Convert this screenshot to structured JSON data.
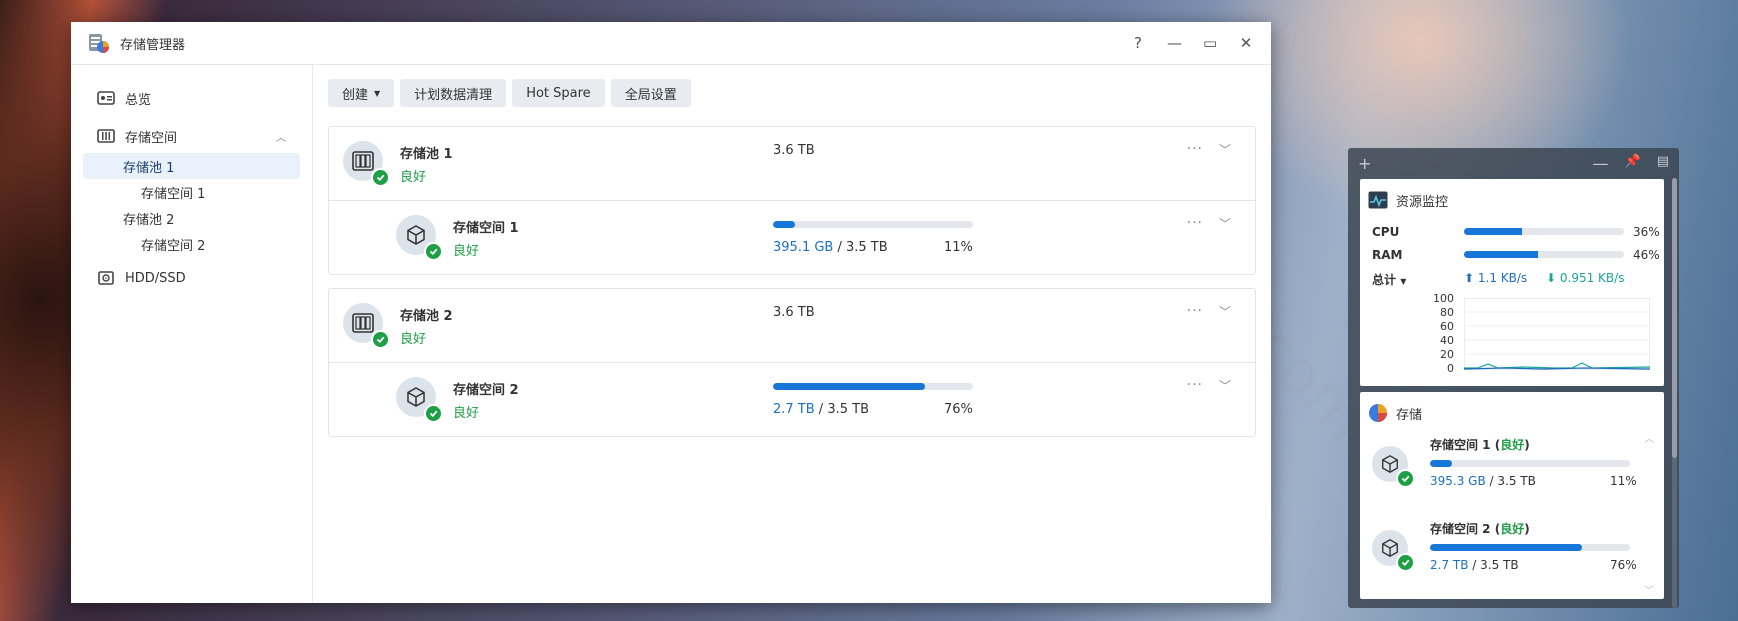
{
  "window": {
    "title": "存储管理器",
    "controls": {
      "help": "?",
      "minimize": "—",
      "maximize": "▭",
      "close": "✕"
    }
  },
  "sidebar": {
    "items": [
      {
        "label": "总览",
        "icon": "overview-icon"
      },
      {
        "label": "存储空间",
        "icon": "storage-icon",
        "expanded": true
      },
      {
        "label": "存储池 1"
      },
      {
        "label": "存储空间 1"
      },
      {
        "label": "存储池 2"
      },
      {
        "label": "存储空间 2"
      },
      {
        "label": "HDD/SSD",
        "icon": "disk-icon"
      }
    ]
  },
  "toolbar": {
    "create": "创建",
    "scrub": "计划数据清理",
    "hotspare": "Hot Spare",
    "settings": "全局设置"
  },
  "pools": [
    {
      "name": "存储池 1",
      "status": "良好",
      "size": "3.6 TB",
      "volume": {
        "name": "存储空间 1",
        "status": "良好",
        "used": "395.1 GB",
        "total": "3.5 TB",
        "percent": "11%",
        "fraction": 0.11
      }
    },
    {
      "name": "存储池 2",
      "status": "良好",
      "size": "3.6 TB",
      "volume": {
        "name": "存储空间 2",
        "status": "良好",
        "used": "2.7 TB",
        "total": "3.5 TB",
        "percent": "76%",
        "fraction": 0.76
      }
    }
  ],
  "widget": {
    "monitor": {
      "title": "资源监控",
      "cpu_label": "CPU",
      "cpu_pct": "36%",
      "cpu_fraction": 0.36,
      "ram_label": "RAM",
      "ram_pct": "46%",
      "ram_fraction": 0.46,
      "total_label": "总计",
      "upload": "1.1 KB/s",
      "download": "0.951 KB/s",
      "y_ticks": [
        "100",
        "80",
        "60",
        "40",
        "20",
        "0"
      ]
    },
    "storage": {
      "title": "存储",
      "volumes": [
        {
          "name": "存储空间 1",
          "status": "良好",
          "used": "395.3 GB",
          "total": "3.5 TB",
          "percent": "11%",
          "fraction": 0.11
        },
        {
          "name": "存储空间 2",
          "status": "良好",
          "used": "2.7 TB",
          "total": "3.5 TB",
          "percent": "76%",
          "fraction": 0.76
        }
      ]
    }
  },
  "watermark": "pangruitao.com",
  "colors": {
    "accent": "#1677d9",
    "good": "#1e9e45",
    "link": "#1d6fc0"
  }
}
